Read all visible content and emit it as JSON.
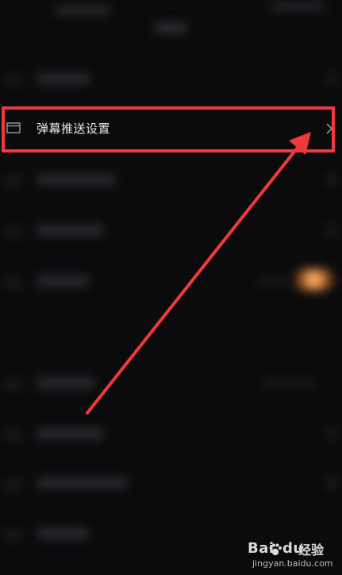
{
  "row": {
    "label": "弹幕推送设置",
    "icon": "window-icon",
    "chevron": "chevron-right-icon"
  },
  "colors": {
    "background": "#0b0b0d",
    "highlight": "#f0393d",
    "arrow": "#f0393d",
    "text": "#e8e8ea"
  },
  "watermark": {
    "brand_prefix": "Bai",
    "brand_suffix": "du",
    "product": "经验",
    "url": "jingyan.baidu.com"
  }
}
